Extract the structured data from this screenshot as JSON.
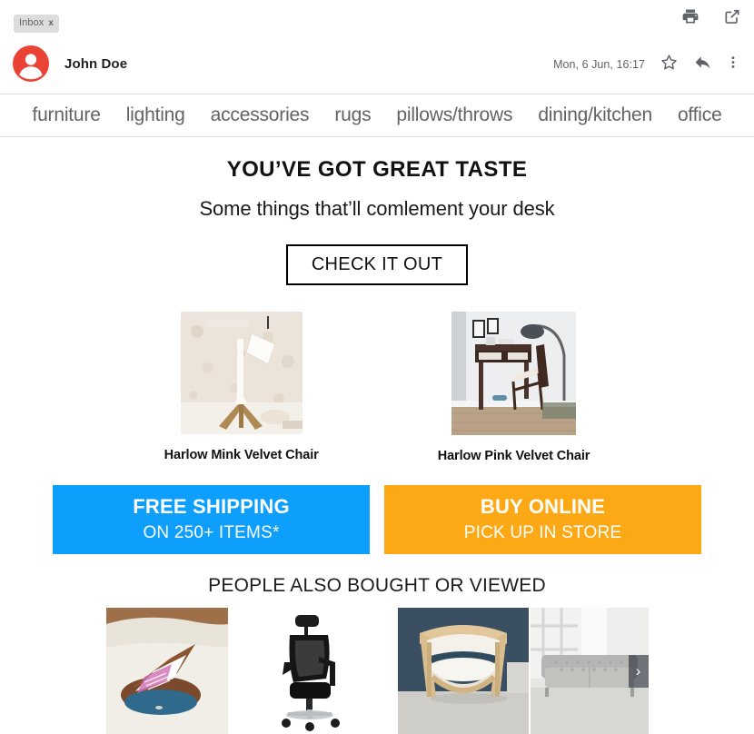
{
  "mail": {
    "inbox_label": "Inbox",
    "inbox_close": "x",
    "sender_name": "John Doe",
    "date": "Mon, 6 Jun, 16:17",
    "icons": {
      "print": "print-icon",
      "open_in_new": "open-in-new-icon",
      "star": "star-icon",
      "reply": "reply-icon",
      "more": "more-options-icon",
      "avatar": "avatar-person-icon"
    }
  },
  "nav": {
    "items": [
      {
        "label": "furniture"
      },
      {
        "label": "lighting"
      },
      {
        "label": "accessories"
      },
      {
        "label": "rugs"
      },
      {
        "label": "pillows/throws"
      },
      {
        "label": "dining/kitchen"
      },
      {
        "label": "office"
      }
    ]
  },
  "hero": {
    "title": "YOU’VE GOT GREAT TASTE",
    "subtitle": "Some things that’ll comlement your desk",
    "cta_label": "CHECK IT OUT"
  },
  "featured": {
    "products": [
      {
        "label": "Harlow Mink Velvet Chair",
        "image_name": "desk-lamp-photo"
      },
      {
        "label": "Harlow Pink Velvet Chair",
        "image_name": "corner-desk-chair-photo"
      }
    ]
  },
  "promos": [
    {
      "title": "FREE SHIPPING",
      "subtitle": "ON 250+ ITEMS*",
      "color": "#0d9ffb"
    },
    {
      "title": "BUY ONLINE",
      "subtitle": "PICK UP IN STORE",
      "color": "#fca915"
    }
  ],
  "also_bought": {
    "title": "PEOPLE ALSO BOUGHT OR VIEWED",
    "next_arrow": "›",
    "items": [
      {
        "image_name": "lap-desk-photo"
      },
      {
        "image_name": "mesh-office-chair-photo"
      },
      {
        "image_name": "wood-barrel-chair-photo"
      },
      {
        "image_name": "grey-tufted-sofa-photo"
      }
    ]
  }
}
